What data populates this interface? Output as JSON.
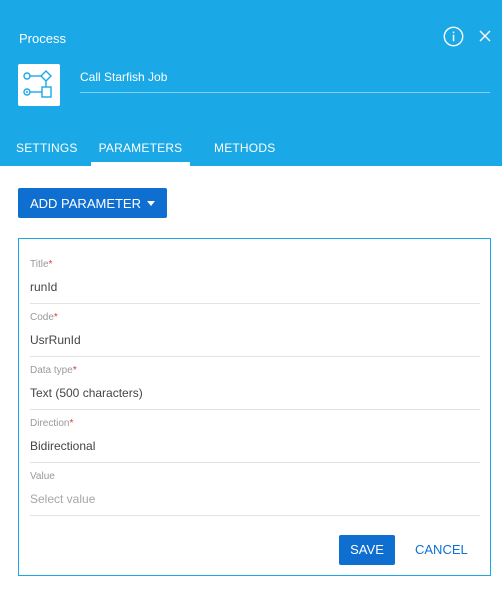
{
  "header": {
    "title": "Process",
    "process_name": "Call Starfish Job",
    "info_icon": "info-icon",
    "close_icon": "close-icon",
    "process_icon": "process-flow-icon",
    "color": "#1aa9e6"
  },
  "tabs": [
    {
      "label": "SETTINGS",
      "active": false
    },
    {
      "label": "PARAMETERS",
      "active": true
    },
    {
      "label": "METHODS",
      "active": false
    }
  ],
  "add_parameter": {
    "label": "ADD PARAMETER",
    "caret_icon": "caret-down-icon"
  },
  "form": {
    "fields": [
      {
        "label": "Title",
        "required": true,
        "value": "runId",
        "placeholder": ""
      },
      {
        "label": "Code",
        "required": true,
        "value": "UsrRunId",
        "placeholder": ""
      },
      {
        "label": "Data type",
        "required": true,
        "value": "Text (500 characters)",
        "placeholder": ""
      },
      {
        "label": "Direction",
        "required": true,
        "value": "Bidirectional",
        "placeholder": ""
      },
      {
        "label": "Value",
        "required": false,
        "value": "",
        "placeholder": "Select value"
      }
    ],
    "required_mark": "*",
    "save_label": "SAVE",
    "cancel_label": "CANCEL"
  },
  "colors": {
    "accent_blue": "#0e6fd1",
    "header_blue": "#1aa9e6",
    "required_red": "#e23636"
  }
}
